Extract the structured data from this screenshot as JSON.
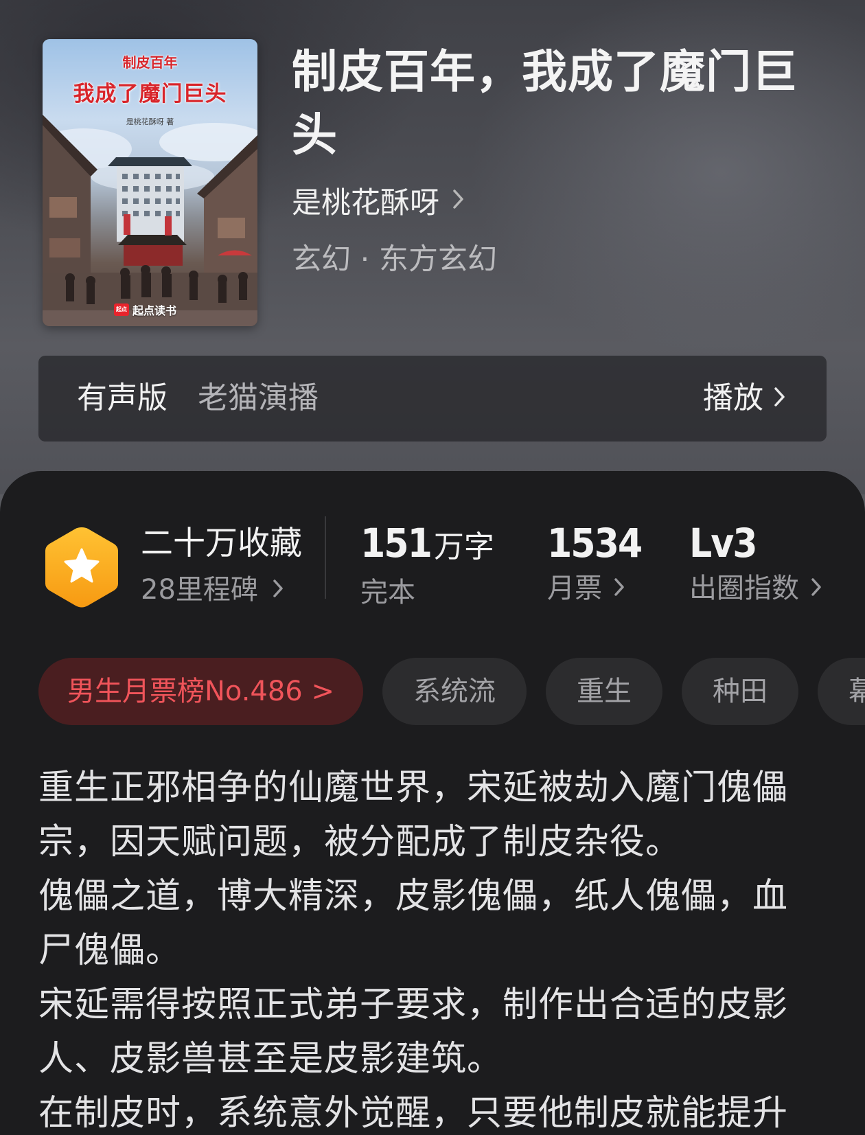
{
  "book": {
    "title": "制皮百年，我成了魔门巨头",
    "author": "是桃花酥呀",
    "genre": "玄幻 · 东方玄幻"
  },
  "cover": {
    "title_small": "制皮百年",
    "title_big": "我成了魔门巨头",
    "author_line": "是桃花酥呀 著",
    "publisher": "起点读书",
    "publisher_logo": "起点"
  },
  "audio": {
    "label": "有声版",
    "narrator": "老猫演播",
    "play_label": "播放"
  },
  "stats": {
    "collections": "二十万收藏",
    "milestones": "28里程碑",
    "word_count": "151",
    "word_unit": "万字",
    "status": "完本",
    "monthly_votes": "1534",
    "monthly_votes_label": "月票",
    "level": "Lv3",
    "level_label": "出圈指数"
  },
  "tags": {
    "rank": "男生月票榜No.486 >",
    "items": [
      "系统流",
      "重生",
      "种田",
      "幕"
    ]
  },
  "synopsis": {
    "paragraphs": [
      "重生正邪相争的仙魔世界，宋延被劫入魔门傀儡宗，因天赋问题，被分配成了制皮杂役。",
      "傀儡之道，博大精深，皮影傀儡，纸人傀儡，血尸傀儡。",
      "宋延需得按照正式弟子要求，制作出合适的皮影人、皮影兽甚至是皮影建筑。",
      "在制皮时，系统意外觉醒，只要他制皮就能提升"
    ]
  },
  "colors": {
    "panel_bg": "#1c1c1e",
    "rank_text": "#f0545a",
    "rank_bg": "#4a1e20",
    "badge": "#f7a51d"
  },
  "icons": {
    "author_chevron": "chevron-right-icon",
    "play_chevron": "chevron-right-icon",
    "badge": "star-hexagon-icon"
  }
}
